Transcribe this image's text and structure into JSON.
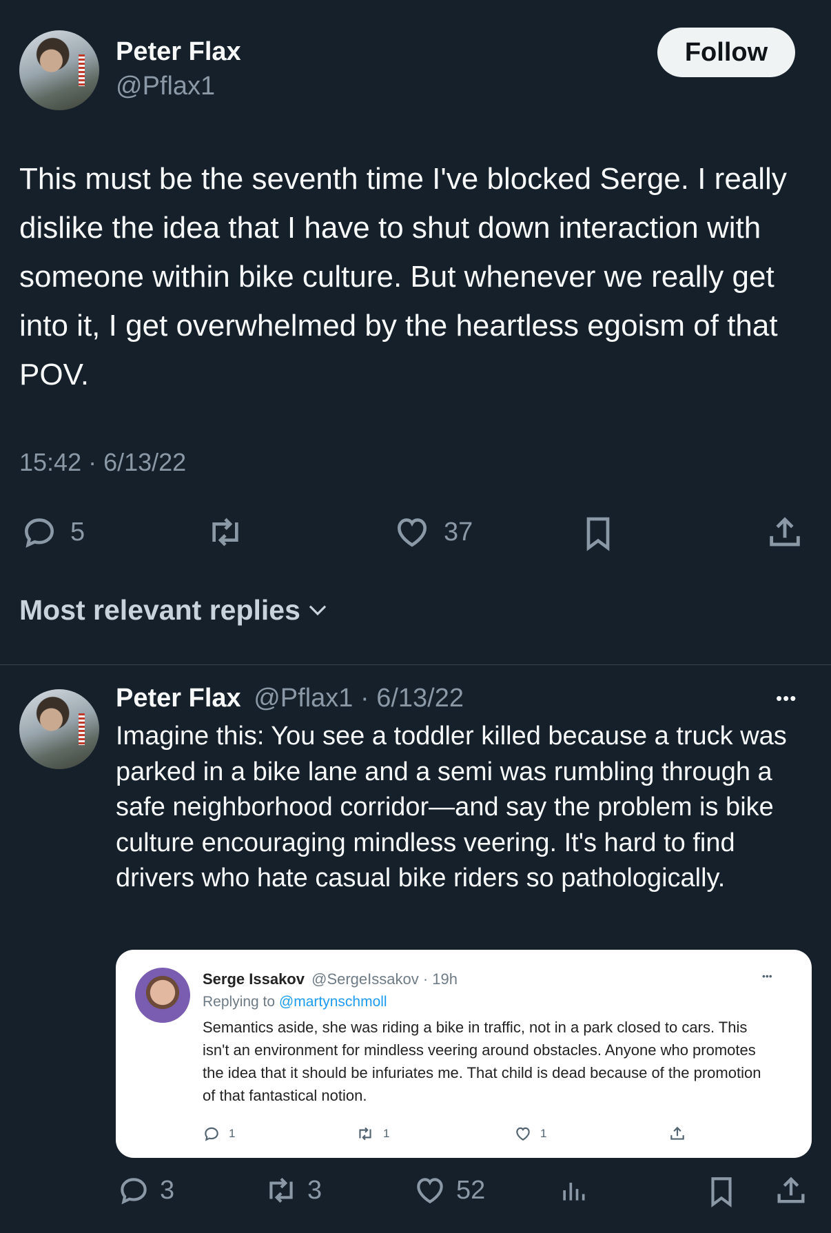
{
  "tweet": {
    "author_name": "Peter Flax",
    "author_handle": "@Pflax1",
    "follow_label": "Follow",
    "text": "This must be the seventh time I've blocked Serge. I really dislike the idea that I have to shut down interaction with someone within bike culture. But whenever we really get into it, I get overwhelmed by the heartless egoism of that POV.",
    "time": "15:42 · 6/13/22",
    "reply_count": "5",
    "like_count": "37"
  },
  "replies_header": "Most relevant replies",
  "reply": {
    "author_name": "Peter Flax",
    "author_handle": "@Pflax1",
    "date": "· 6/13/22",
    "more_label": "•••",
    "text": "Imagine this: You see a toddler killed because a truck was parked in a bike lane and a semi was rumbling through a safe neighborhood corridor—and say the problem is bike culture encouraging mindless veering. It's hard to find drivers who hate casual bike riders so pathologically.",
    "reply_count": "3",
    "retweet_count": "3",
    "like_count": "52"
  },
  "quoted": {
    "author_name": "Serge Issakov",
    "author_handle": "@SergeIssakov",
    "time": "· 19h",
    "more_label": "•••",
    "replying_prefix": "Replying to",
    "replying_to": "@martynschmoll",
    "text": "Semantics aside, she was riding a bike in traffic, not in a park closed to cars. This isn't an environment for mindless veering around obstacles. Anyone who promotes the idea that it should be infuriates me. That child is dead because of the promotion of that fantastical notion.",
    "reply_count": "1",
    "retweet_count": "1",
    "like_count": "1"
  },
  "colors": {
    "background": "#15202b",
    "secondary_text": "#8b98a5",
    "link": "#1d9bf0"
  }
}
